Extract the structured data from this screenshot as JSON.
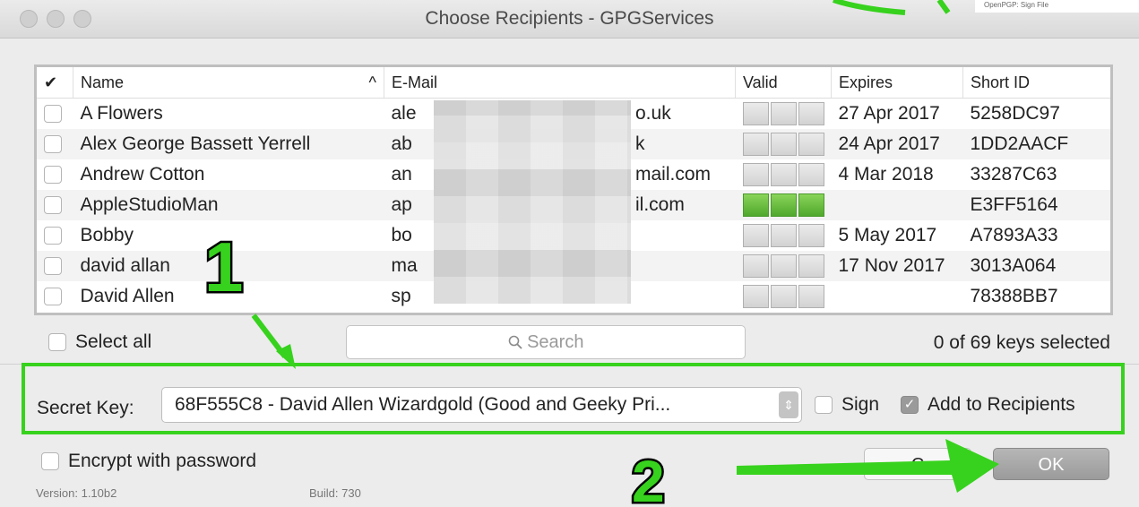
{
  "window": {
    "title": "Choose Recipients - GPGServices"
  },
  "background_snippet": "OpenPGP: Sign File",
  "table": {
    "headers": {
      "check": "✔",
      "name": "Name",
      "sort": "^",
      "email": "E-Mail",
      "valid": "Valid",
      "expires": "Expires",
      "short_id": "Short ID"
    },
    "rows": [
      {
        "name": "A Flowers",
        "email": "ale",
        "email_end": "o.uk",
        "expires": "27 Apr 2017",
        "short_id": "5258DC97",
        "valid": "grey"
      },
      {
        "name": "Alex George Bassett Yerrell",
        "email": "ab",
        "email_end": "k",
        "expires": "24 Apr 2017",
        "short_id": "1DD2AACF",
        "valid": "grey"
      },
      {
        "name": "Andrew Cotton",
        "email": "an",
        "email_end": "mail.com",
        "expires": "4 Mar 2018",
        "short_id": "33287C63",
        "valid": "grey"
      },
      {
        "name": "AppleStudioMan",
        "email": "ap",
        "email_end": "il.com",
        "expires": "",
        "short_id": "E3FF5164",
        "valid": "green"
      },
      {
        "name": "Bobby",
        "email": "bo",
        "email_end": "",
        "expires": "5 May 2017",
        "short_id": "A7893A33",
        "valid": "grey"
      },
      {
        "name": "david allan",
        "email": "ma",
        "email_end": "",
        "expires": "17 Nov 2017",
        "short_id": "3013A064",
        "valid": "grey"
      },
      {
        "name": "David Allen",
        "email": "sp",
        "email_end": "",
        "expires": "",
        "short_id": "78388BB7",
        "valid": "grey"
      }
    ]
  },
  "select_all": "Select all",
  "search": {
    "placeholder": "Search",
    "icon": "search-icon"
  },
  "key_count": "0 of 69 keys selected",
  "secret_key": {
    "label": "Secret Key:",
    "value": "68F555C8 - David Allen Wizardgold (Good and Geeky Pri..."
  },
  "sign": {
    "label": "Sign",
    "checked": false
  },
  "add_to_recipients": {
    "label": "Add to Recipients",
    "checked": true
  },
  "encrypt": {
    "label": "Encrypt with password",
    "checked": false
  },
  "footer": {
    "version": "Version: 1.10b2",
    "build": "Build: 730"
  },
  "buttons": {
    "cancel": "C",
    "ok": "OK"
  },
  "annotations": {
    "step1": "1",
    "step2": "2",
    "color": "#37d21d"
  }
}
